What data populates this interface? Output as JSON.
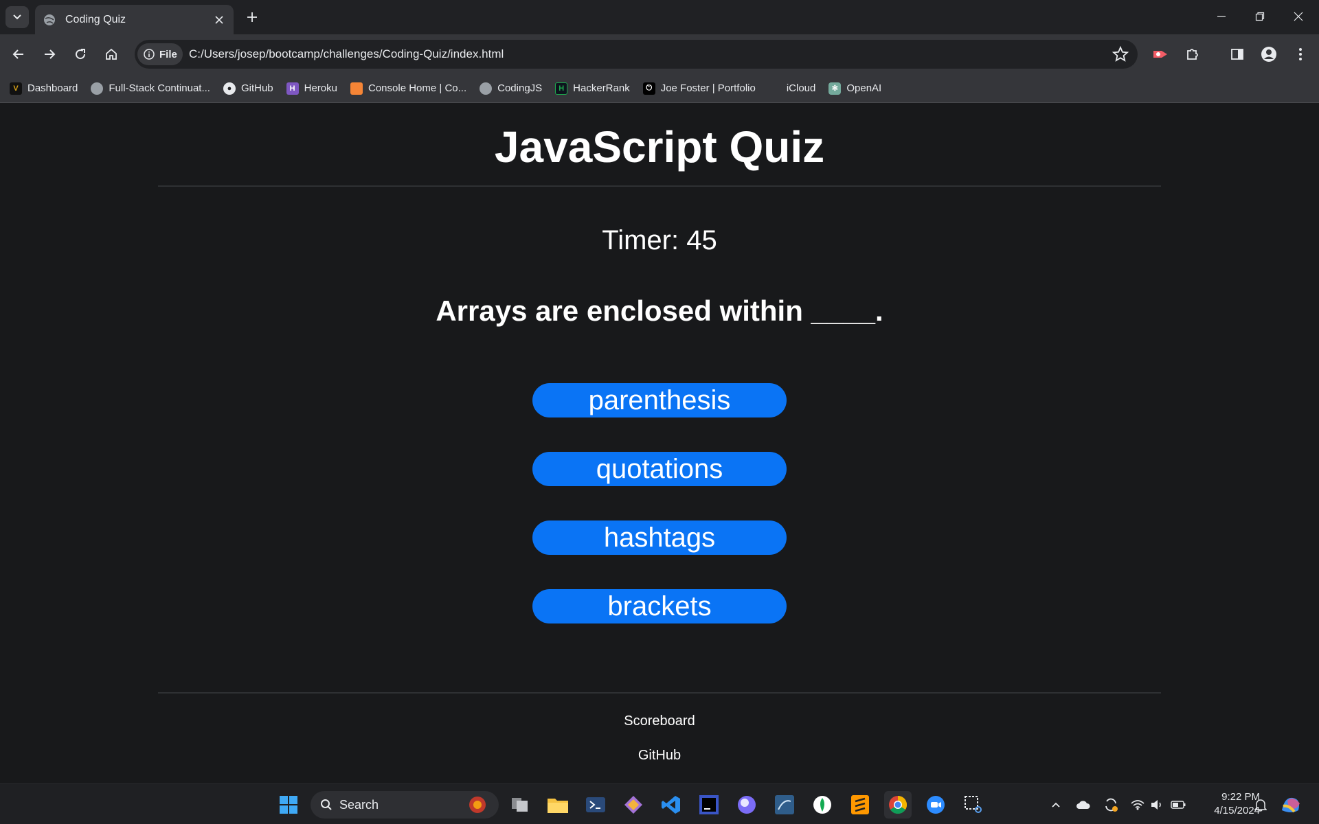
{
  "browser": {
    "tab_title": "Coding Quiz",
    "url_chip": "File",
    "url": "C:/Users/josep/bootcamp/challenges/Coding-Quiz/index.html",
    "bookmarks": [
      {
        "label": "Dashboard",
        "icon": "v-logo-icon"
      },
      {
        "label": "Full-Stack Continuat...",
        "icon": "globe-icon"
      },
      {
        "label": "GitHub",
        "icon": "github-icon"
      },
      {
        "label": "Heroku",
        "icon": "heroku-icon"
      },
      {
        "label": "Console Home | Co...",
        "icon": "aws-cube-icon"
      },
      {
        "label": "CodingJS",
        "icon": "globe-icon"
      },
      {
        "label": "HackerRank",
        "icon": "hackerrank-icon"
      },
      {
        "label": "Joe Foster | Portfolio",
        "icon": "power-icon"
      },
      {
        "label": "iCloud",
        "icon": "apple-icon"
      },
      {
        "label": "OpenAI",
        "icon": "openai-icon"
      }
    ]
  },
  "quiz": {
    "title": "JavaScript Quiz",
    "timer": "Timer: 45",
    "question": "Arrays are enclosed within ____.",
    "answers": [
      "parenthesis",
      "quotations",
      "hashtags",
      "brackets"
    ],
    "footer_links": [
      "Scoreboard",
      "GitHub"
    ]
  },
  "taskbar": {
    "search_placeholder": "Search",
    "time": "9:22 PM",
    "date": "4/15/2024"
  },
  "colors": {
    "page_bg": "#18191b",
    "answer_button": "#0a74f5",
    "chrome_dark": "#202124",
    "chrome_toolbar": "#35363a"
  }
}
